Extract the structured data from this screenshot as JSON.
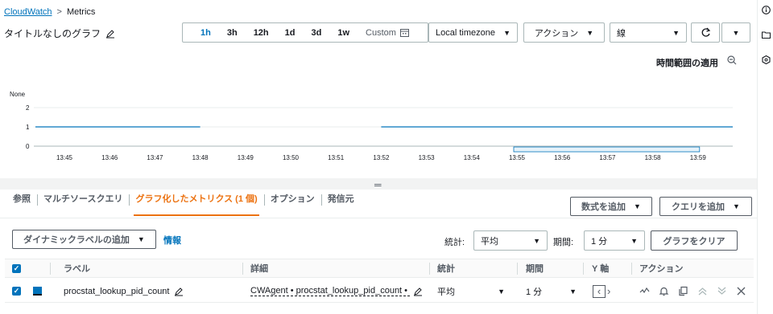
{
  "breadcrumb": {
    "link": "CloudWatch",
    "separator": ">",
    "current": "Metrics"
  },
  "title": "タイトルなしのグラフ",
  "time_ranges": [
    "1h",
    "3h",
    "12h",
    "1d",
    "3d",
    "1w"
  ],
  "active_range": "1h",
  "custom_label": "Custom",
  "timezone": "Local timezone",
  "actions_label": "アクション",
  "chart_type": "線",
  "apply_time_range": "時間範囲の適用",
  "chart_data": {
    "type": "line",
    "ylabel": "None",
    "yticks": [
      "2",
      "1",
      "0"
    ],
    "ylim": [
      0,
      2.6
    ],
    "x_ticks": [
      "13:45",
      "13:46",
      "13:47",
      "13:48",
      "13:49",
      "13:50",
      "13:51",
      "13:52",
      "13:53",
      "13:54",
      "13:55",
      "13:56",
      "13:57",
      "13:58",
      "13:59"
    ],
    "series": [
      {
        "color": "#0073bb",
        "segments": [
          {
            "from": "13:44",
            "to": "13:48",
            "value": 1
          },
          {
            "from": "13:52",
            "to": "14:00",
            "value": 1
          }
        ]
      }
    ],
    "brush": {
      "from": "13:55",
      "to": "13:59"
    },
    "grid": true
  },
  "tabs": [
    "参照",
    "マルチソースクエリ",
    "グラフ化したメトリクス (1 個)",
    "オプション",
    "発信元"
  ],
  "active_tab": 2,
  "add_math": "数式を追加",
  "add_query": "クエリを追加",
  "dynamic_label_button": "ダイナミックラベルの追加",
  "info_link": "情報",
  "stat_label": "統計:",
  "stat_value": "平均",
  "period_label": "期間:",
  "period_value": "1 分",
  "clear_graph": "グラフをクリア",
  "columns": {
    "label": "ラベル",
    "details": "詳細",
    "stat": "統計",
    "period": "期間",
    "yaxis": "Y 軸",
    "actions": "アクション"
  },
  "metric_row": {
    "label": "procstat_lookup_pid_count",
    "details": "CWAgent • procstat_lookup_pid_count • (",
    "stat": "平均",
    "period": "1 分",
    "color": "#0073bb"
  }
}
